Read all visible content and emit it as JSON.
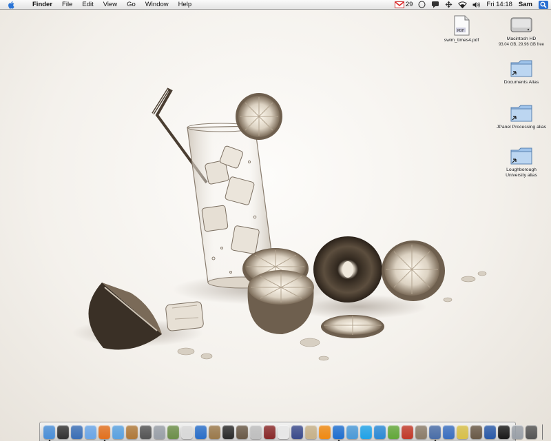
{
  "menubar": {
    "app_name": "Finder",
    "menus": [
      "File",
      "Edit",
      "View",
      "Go",
      "Window",
      "Help"
    ],
    "gmail_count": "29",
    "clock": "Fri 14:18",
    "user": "Sam",
    "icons": [
      "gmail-icon",
      "clock-status-icon",
      "chat-bubble-icon",
      "move-arrows-icon",
      "wifi-icon",
      "volume-icon",
      "spotlight-icon"
    ]
  },
  "desktop": {
    "icons": [
      {
        "label": "swim_times4.pdf",
        "sub": "",
        "kind": "pdf-icon"
      },
      {
        "label": "Macintosh HD",
        "sub": "93.04 GB, 29.96 GB free",
        "kind": "hard-drive-icon"
      },
      {
        "label": "Documents Alias",
        "sub": "",
        "kind": "folder-alias-icon"
      },
      {
        "label": "JPanel Processing alias",
        "sub": "",
        "kind": "folder-alias-icon"
      },
      {
        "label": "Loughborough University alias",
        "sub": "",
        "kind": "folder-alias-icon"
      }
    ]
  },
  "dock": {
    "apps": [
      {
        "name": "finder",
        "color": "#4a8fd8",
        "running": true
      },
      {
        "name": "dashboard",
        "color": "#333333",
        "running": false
      },
      {
        "name": "compass",
        "color": "#3b6fb6",
        "running": false
      },
      {
        "name": "safari",
        "color": "#6aa6e8",
        "running": false
      },
      {
        "name": "firefox",
        "color": "#e3711f",
        "running": true
      },
      {
        "name": "itunes",
        "color": "#5aa2e0",
        "running": false
      },
      {
        "name": "photo",
        "color": "#b07a3a",
        "running": false
      },
      {
        "name": "imovie",
        "color": "#555555",
        "running": false
      },
      {
        "name": "preview",
        "color": "#9aa0a8",
        "running": false
      },
      {
        "name": "tree",
        "color": "#6d8f4a",
        "running": false
      },
      {
        "name": "ipod",
        "color": "#d9d9d9",
        "running": false
      },
      {
        "name": "network",
        "color": "#2a6fc9",
        "running": false
      },
      {
        "name": "book",
        "color": "#9b7a4c",
        "running": false
      },
      {
        "name": "silhouette",
        "color": "#2b2b2b",
        "running": false
      },
      {
        "name": "sherlock",
        "color": "#6a5a48",
        "running": false
      },
      {
        "name": "calculator",
        "color": "#bfbfbf",
        "running": false
      },
      {
        "name": "dictionary",
        "color": "#8a2a2a",
        "running": false
      },
      {
        "name": "textedit",
        "color": "#e8e8e8",
        "running": false
      },
      {
        "name": "pen",
        "color": "#3c4c8c",
        "running": false
      },
      {
        "name": "script",
        "color": "#c7b28a",
        "running": false
      },
      {
        "name": "vlc",
        "color": "#f08a12",
        "running": false
      },
      {
        "name": "quicktime",
        "color": "#1f6fd0",
        "running": true
      },
      {
        "name": "chat",
        "color": "#4b9ad8",
        "running": false
      },
      {
        "name": "skype",
        "color": "#21a3e8",
        "running": false
      },
      {
        "name": "swoosh",
        "color": "#2c8ad6",
        "running": false
      },
      {
        "name": "puzzle",
        "color": "#63a83a",
        "running": false
      },
      {
        "name": "pdf-reader",
        "color": "#c23a2a",
        "running": false
      },
      {
        "name": "tools",
        "color": "#8c7d6a",
        "running": false
      },
      {
        "name": "screens",
        "color": "#4a6ea8",
        "running": true
      },
      {
        "name": "activity",
        "color": "#3a6fc0",
        "running": false
      },
      {
        "name": "ribbon",
        "color": "#d8c04a",
        "running": false
      },
      {
        "name": "pencil",
        "color": "#6a5a48",
        "running": false
      },
      {
        "name": "globe",
        "color": "#2a5aa8",
        "running": false
      },
      {
        "name": "terminal",
        "color": "#1a1a1a",
        "running": false
      },
      {
        "name": "system",
        "color": "#9aa0a8",
        "running": false
      },
      {
        "name": "camera",
        "color": "#555555",
        "running": false
      }
    ],
    "trash_label": "trash-icon"
  },
  "colors": {
    "wallpaper_bg": "#f4f1ec",
    "sepia_dark": "#3a3026",
    "sepia_mid": "#9c8c78",
    "folder_blue": "#8fb8e6"
  }
}
